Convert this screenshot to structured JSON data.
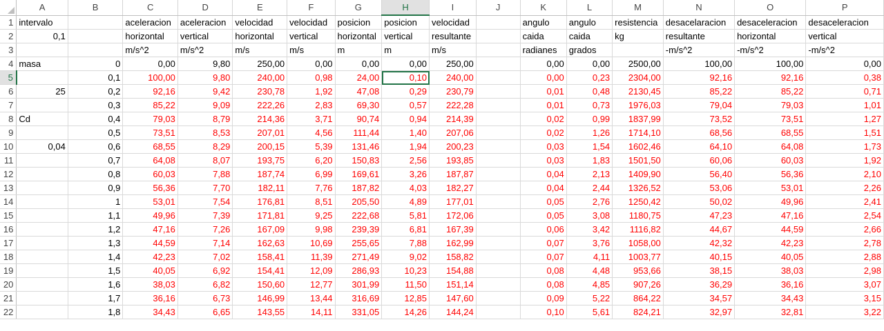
{
  "columns": [
    "A",
    "B",
    "C",
    "D",
    "E",
    "F",
    "G",
    "H",
    "I",
    "J",
    "K",
    "L",
    "M",
    "N",
    "O",
    "P"
  ],
  "active_cell": {
    "row": 5,
    "col": "H"
  },
  "accent_color": "#217346",
  "value_color": "#ff0000",
  "header_rows": [
    {
      "row": "1",
      "cells": [
        "intervalo",
        "",
        "aceleracion",
        "aceleracion",
        "velocidad",
        "velocidad",
        "posicion",
        "posicion",
        "velocidad",
        "",
        "angulo",
        "angulo",
        "resistencia",
        "desacelaracion",
        "desaceleracion",
        "desaceleracion"
      ]
    },
    {
      "row": "2",
      "cells": [
        "0,1",
        "",
        "horizontal",
        "vertical",
        "horizontal",
        "vertical",
        "horizontal",
        "vertical",
        "resultante",
        "",
        "caida",
        "caida",
        "kg",
        "resultante",
        "horizontal",
        "vertical"
      ]
    },
    {
      "row": "3",
      "cells": [
        "",
        "",
        "m/s^2",
        "m/s^2",
        "m/s",
        "m/s",
        "m",
        "m",
        "m/s",
        "",
        "radianes",
        "grados",
        "",
        "-m/s^2",
        "-m/s^2",
        "-m/s^2"
      ]
    }
  ],
  "data_rows": [
    {
      "row": "4",
      "a": "masa",
      "b": "0",
      "v": [
        "0,00",
        "9,80",
        "250,00",
        "0,00",
        "0,00",
        "0,00",
        "250,00",
        "",
        "0,00",
        "0,00",
        "2500,00",
        "100,00",
        "100,00",
        "0,00"
      ]
    },
    {
      "row": "5",
      "a": "",
      "b": "0,1",
      "v": [
        "100,00",
        "9,80",
        "240,00",
        "0,98",
        "24,00",
        "0,10",
        "240,00",
        "",
        "0,00",
        "0,23",
        "2304,00",
        "92,16",
        "92,16",
        "0,38"
      ]
    },
    {
      "row": "6",
      "a": "25",
      "b": "0,2",
      "v": [
        "92,16",
        "9,42",
        "230,78",
        "1,92",
        "47,08",
        "0,29",
        "230,79",
        "",
        "0,01",
        "0,48",
        "2130,45",
        "85,22",
        "85,22",
        "0,71"
      ]
    },
    {
      "row": "7",
      "a": "",
      "b": "0,3",
      "v": [
        "85,22",
        "9,09",
        "222,26",
        "2,83",
        "69,30",
        "0,57",
        "222,28",
        "",
        "0,01",
        "0,73",
        "1976,03",
        "79,04",
        "79,03",
        "1,01"
      ]
    },
    {
      "row": "8",
      "a": "Cd",
      "b": "0,4",
      "v": [
        "79,03",
        "8,79",
        "214,36",
        "3,71",
        "90,74",
        "0,94",
        "214,39",
        "",
        "0,02",
        "0,99",
        "1837,99",
        "73,52",
        "73,51",
        "1,27"
      ]
    },
    {
      "row": "9",
      "a": "",
      "b": "0,5",
      "v": [
        "73,51",
        "8,53",
        "207,01",
        "4,56",
        "111,44",
        "1,40",
        "207,06",
        "",
        "0,02",
        "1,26",
        "1714,10",
        "68,56",
        "68,55",
        "1,51"
      ]
    },
    {
      "row": "10",
      "a": "0,04",
      "b": "0,6",
      "v": [
        "68,55",
        "8,29",
        "200,15",
        "5,39",
        "131,46",
        "1,94",
        "200,23",
        "",
        "0,03",
        "1,54",
        "1602,46",
        "64,10",
        "64,08",
        "1,73"
      ]
    },
    {
      "row": "11",
      "a": "",
      "b": "0,7",
      "v": [
        "64,08",
        "8,07",
        "193,75",
        "6,20",
        "150,83",
        "2,56",
        "193,85",
        "",
        "0,03",
        "1,83",
        "1501,50",
        "60,06",
        "60,03",
        "1,92"
      ]
    },
    {
      "row": "12",
      "a": "",
      "b": "0,8",
      "v": [
        "60,03",
        "7,88",
        "187,74",
        "6,99",
        "169,61",
        "3,26",
        "187,87",
        "",
        "0,04",
        "2,13",
        "1409,90",
        "56,40",
        "56,36",
        "2,10"
      ]
    },
    {
      "row": "13",
      "a": "",
      "b": "0,9",
      "v": [
        "56,36",
        "7,70",
        "182,11",
        "7,76",
        "187,82",
        "4,03",
        "182,27",
        "",
        "0,04",
        "2,44",
        "1326,52",
        "53,06",
        "53,01",
        "2,26"
      ]
    },
    {
      "row": "14",
      "a": "",
      "b": "1",
      "v": [
        "53,01",
        "7,54",
        "176,81",
        "8,51",
        "205,50",
        "4,89",
        "177,01",
        "",
        "0,05",
        "2,76",
        "1250,42",
        "50,02",
        "49,96",
        "2,41"
      ]
    },
    {
      "row": "15",
      "a": "",
      "b": "1,1",
      "v": [
        "49,96",
        "7,39",
        "171,81",
        "9,25",
        "222,68",
        "5,81",
        "172,06",
        "",
        "0,05",
        "3,08",
        "1180,75",
        "47,23",
        "47,16",
        "2,54"
      ]
    },
    {
      "row": "16",
      "a": "",
      "b": "1,2",
      "v": [
        "47,16",
        "7,26",
        "167,09",
        "9,98",
        "239,39",
        "6,81",
        "167,39",
        "",
        "0,06",
        "3,42",
        "1116,82",
        "44,67",
        "44,59",
        "2,66"
      ]
    },
    {
      "row": "17",
      "a": "",
      "b": "1,3",
      "v": [
        "44,59",
        "7,14",
        "162,63",
        "10,69",
        "255,65",
        "7,88",
        "162,99",
        "",
        "0,07",
        "3,76",
        "1058,00",
        "42,32",
        "42,23",
        "2,78"
      ]
    },
    {
      "row": "18",
      "a": "",
      "b": "1,4",
      "v": [
        "42,23",
        "7,02",
        "158,41",
        "11,39",
        "271,49",
        "9,02",
        "158,82",
        "",
        "0,07",
        "4,11",
        "1003,77",
        "40,15",
        "40,05",
        "2,88"
      ]
    },
    {
      "row": "19",
      "a": "",
      "b": "1,5",
      "v": [
        "40,05",
        "6,92",
        "154,41",
        "12,09",
        "286,93",
        "10,23",
        "154,88",
        "",
        "0,08",
        "4,48",
        "953,66",
        "38,15",
        "38,03",
        "2,98"
      ]
    },
    {
      "row": "20",
      "a": "",
      "b": "1,6",
      "v": [
        "38,03",
        "6,82",
        "150,60",
        "12,77",
        "301,99",
        "11,50",
        "151,14",
        "",
        "0,08",
        "4,85",
        "907,26",
        "36,29",
        "36,16",
        "3,07"
      ]
    },
    {
      "row": "21",
      "a": "",
      "b": "1,7",
      "v": [
        "36,16",
        "6,73",
        "146,99",
        "13,44",
        "316,69",
        "12,85",
        "147,60",
        "",
        "0,09",
        "5,22",
        "864,22",
        "34,57",
        "34,43",
        "3,15"
      ]
    },
    {
      "row": "22",
      "a": "",
      "b": "1,8",
      "v": [
        "34,43",
        "6,65",
        "143,55",
        "14,11",
        "331,05",
        "14,26",
        "144,24",
        "",
        "0,10",
        "5,61",
        "824,21",
        "32,97",
        "32,81",
        "3,22"
      ]
    }
  ]
}
